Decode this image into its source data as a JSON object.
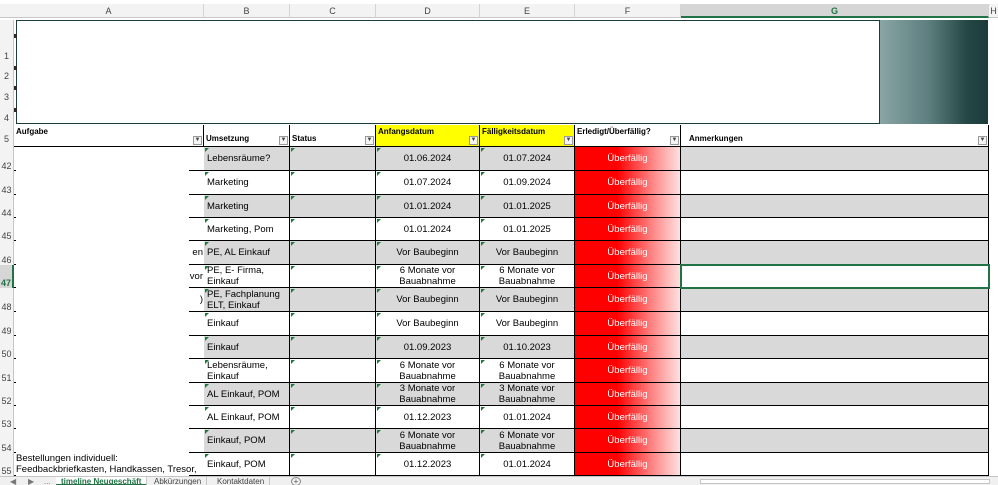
{
  "columns": [
    "A",
    "B",
    "C",
    "D",
    "E",
    "F",
    "G",
    "H"
  ],
  "selected_column": "G",
  "top_rows": [
    "1",
    "2",
    "3",
    "4",
    "5"
  ],
  "headers": {
    "aufgabe": "Aufgabe",
    "umsetzung": "Umsetzung",
    "status": "Status",
    "anfangsdatum": "Anfangsdatum",
    "faelligkeitsdatum": "Fälligkeitsdatum",
    "erledigt": "Erledigt/Überfällig?",
    "anmerkungen": "Anmerkungen"
  },
  "colors": {
    "yellow_header": "#ffff00",
    "gray_row": "#d9d9d9",
    "overdue": "#ff0000",
    "excel_green": "#217346",
    "banner_dark": "#1b3b39"
  },
  "rows": [
    {
      "num": "42",
      "umsetzung": "Lebensräume?",
      "anfang": "01.06.2024",
      "faellig": "01.07.2024",
      "status": "Überfällig",
      "a_clip": ""
    },
    {
      "num": "43",
      "umsetzung": "Marketing",
      "anfang": "01.07.2024",
      "faellig": "01.09.2024",
      "status": "Überfällig",
      "a_clip": ""
    },
    {
      "num": "44",
      "umsetzung": "Marketing",
      "anfang": "01.01.2024",
      "faellig": "01.01.2025",
      "status": "Überfällig",
      "a_clip": ""
    },
    {
      "num": "45",
      "umsetzung": "Marketing, Pom",
      "anfang": "01.01.2024",
      "faellig": "01.01.2025",
      "status": "Überfällig",
      "a_clip": ""
    },
    {
      "num": "46",
      "umsetzung": "PE, AL Einkauf",
      "anfang": "Vor Baubeginn",
      "faellig": "Vor Baubeginn",
      "status": "Überfällig",
      "a_clip": "en"
    },
    {
      "num": "47",
      "umsetzung": "PE, E- Firma, Einkauf",
      "anfang": "6 Monate vor Bauabnahme",
      "faellig": "6 Monate vor Bauabnahme",
      "status": "Überfällig",
      "a_clip": "vor"
    },
    {
      "num": "48",
      "umsetzung": "PE, Fachplanung ELT, Einkauf",
      "anfang": "Vor Baubeginn",
      "faellig": "Vor Baubeginn",
      "status": "Überfällig",
      "a_clip": ")"
    },
    {
      "num": "49",
      "umsetzung": "Einkauf",
      "anfang": "Vor Baubeginn",
      "faellig": "Vor Baubeginn",
      "status": "Überfällig",
      "a_clip": ""
    },
    {
      "num": "50",
      "umsetzung": "Einkauf",
      "anfang": "01.09.2023",
      "faellig": "01.10.2023",
      "status": "Überfällig",
      "a_clip": ""
    },
    {
      "num": "51",
      "umsetzung": "Lebensräume, Einkauf",
      "anfang": "6 Monate vor Bauabnahme",
      "faellig": "6 Monate vor Bauabnahme",
      "status": "Überfällig",
      "a_clip": ""
    },
    {
      "num": "52",
      "umsetzung": "AL Einkauf, POM",
      "anfang": "3 Monate vor Bauabnahme",
      "faellig": "3 Monate vor Bauabnahme",
      "status": "Überfällig",
      "a_clip": ""
    },
    {
      "num": "53",
      "umsetzung": "AL Einkauf, POM",
      "anfang": "01.12.2023",
      "faellig": "01.01.2024",
      "status": "Überfällig",
      "a_clip": ""
    },
    {
      "num": "54",
      "umsetzung": "Einkauf, POM",
      "anfang": "6 Monate vor Bauabnahme",
      "faellig": "6 Monate vor Bauabnahme",
      "status": "Überfällig",
      "a_clip": ""
    },
    {
      "num": "55",
      "umsetzung": "Einkauf, POM",
      "anfang": "01.12.2023",
      "faellig": "01.01.2024",
      "status": "Überfällig",
      "a_clip": ""
    }
  ],
  "aufgabe_overflow": {
    "line1": "Bestellungen individuell:",
    "line2": "Feedbackbriefkasten, Handkassen, Tresor,"
  },
  "tabs": [
    {
      "label": "timeline Neugeschäft",
      "active": true
    },
    {
      "label": "Abkürzungen",
      "active": false
    },
    {
      "label": "Kontaktdaten",
      "active": false
    }
  ],
  "tab_nav": {
    "prev": "◀",
    "next": "▶",
    "more": "..."
  },
  "add_tab": "+"
}
